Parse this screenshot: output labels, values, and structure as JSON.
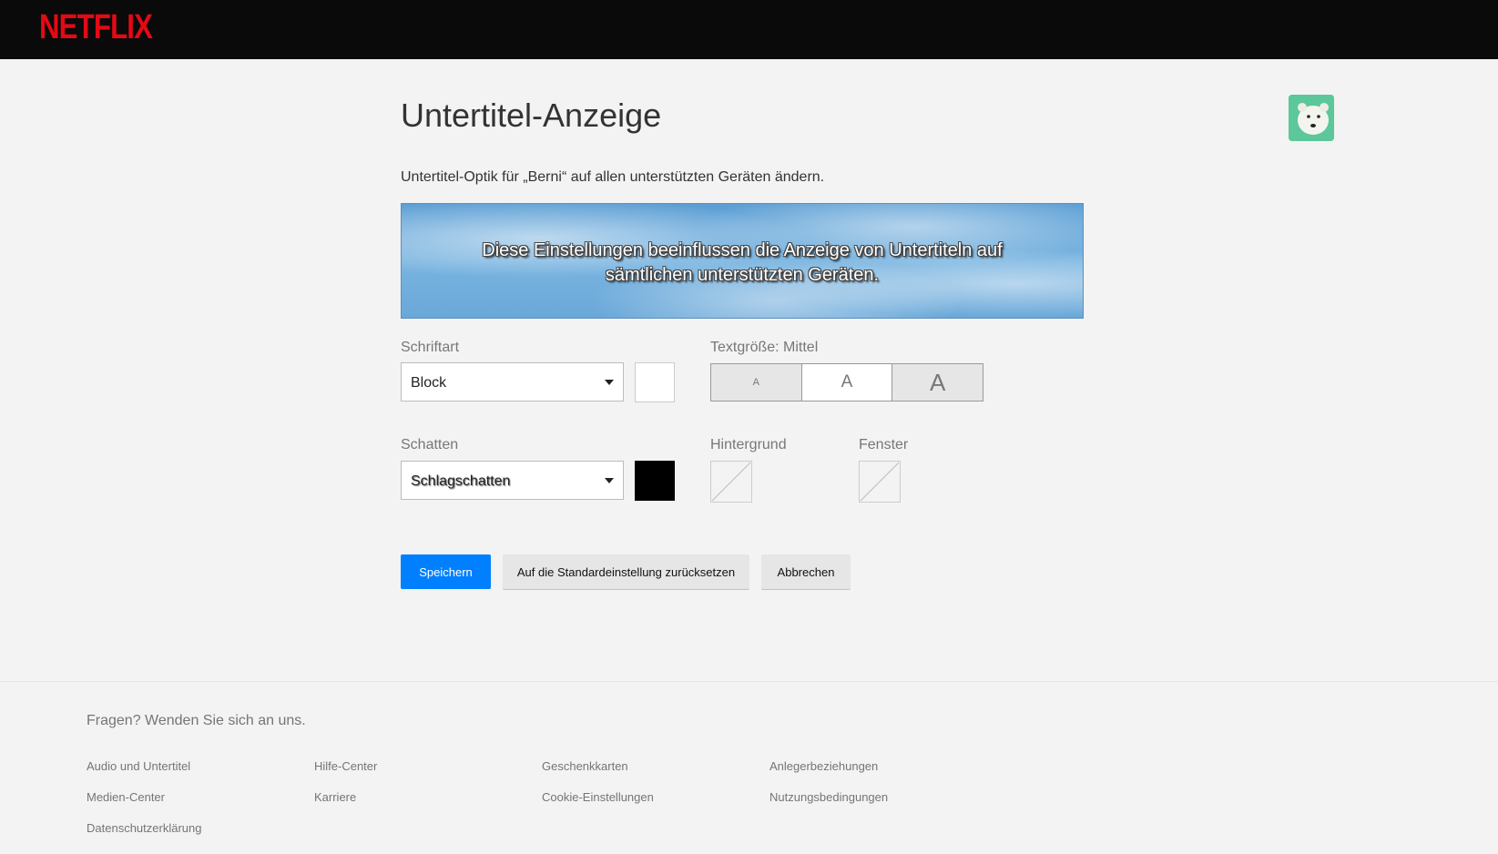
{
  "header": {
    "logo": "NETFLIX"
  },
  "main": {
    "title": "Untertitel-Anzeige",
    "description": "Untertitel-Optik für „Berni“ auf allen unterstützten Geräten ändern.",
    "preview_text": "Diese Einstellungen beeinflussen die Anzeige von Untertiteln auf sämtlichen unterstützten Geräten."
  },
  "font": {
    "label": "Schriftart",
    "selected": "Block",
    "color": "#ffffff"
  },
  "text_size": {
    "label": "Textgröße: Mittel",
    "options": [
      "A",
      "A",
      "A"
    ],
    "selected_index": 1
  },
  "shadow": {
    "label": "Schatten",
    "selected": "Schlagschatten",
    "color": "#000000"
  },
  "background": {
    "label": "Hintergrund"
  },
  "window": {
    "label": "Fenster"
  },
  "buttons": {
    "save": "Speichern",
    "reset": "Auf die Standardeinstellung zurücksetzen",
    "cancel": "Abbrechen"
  },
  "footer": {
    "question": "Fragen? Wenden Sie sich an uns.",
    "links": [
      "Audio und Untertitel",
      "Hilfe-Center",
      "Geschenkkarten",
      "Anlegerbeziehungen",
      "Medien-Center",
      "Karriere",
      "Cookie-Einstellungen",
      "Nutzungsbedingungen",
      "Datenschutzerklärung"
    ]
  },
  "colors": {
    "brand": "#e50914",
    "primary_button": "#0080ff"
  }
}
